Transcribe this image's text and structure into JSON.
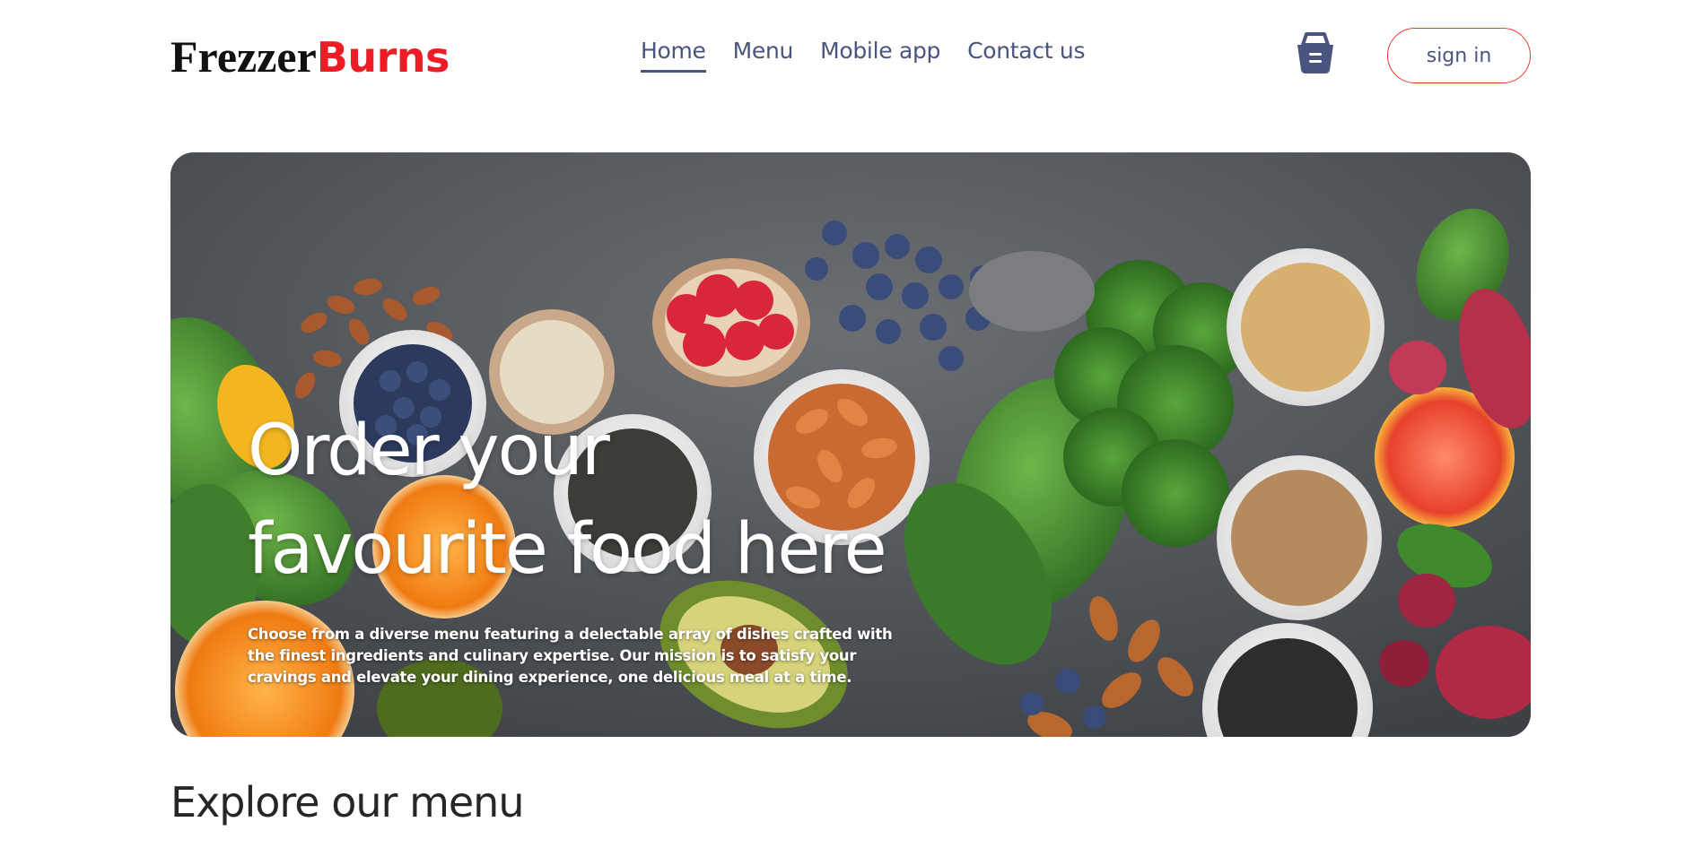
{
  "brand": {
    "part1": "Frezzer",
    "part2": "Burns"
  },
  "nav": {
    "items": [
      {
        "label": "Home",
        "active": true
      },
      {
        "label": "Menu",
        "active": false
      },
      {
        "label": "Mobile app",
        "active": false
      },
      {
        "label": "Contact us",
        "active": false
      }
    ],
    "basket_icon": "basket-icon",
    "signin_label": "sign in"
  },
  "hero": {
    "title_line1": "Order your",
    "title_line2": "favourite food here",
    "description": "Choose from a diverse menu featuring a delectable array of dishes crafted with the finest ingredients and culinary expertise. Our mission is to satisfy your cravings and elevate your dining experience, one delicious meal at a time."
  },
  "explore": {
    "title": "Explore our menu"
  },
  "colors": {
    "brand_accent": "#ee1c24",
    "nav_text": "#49557e",
    "signin_border": "#ee3b2a",
    "heading": "#262626"
  }
}
